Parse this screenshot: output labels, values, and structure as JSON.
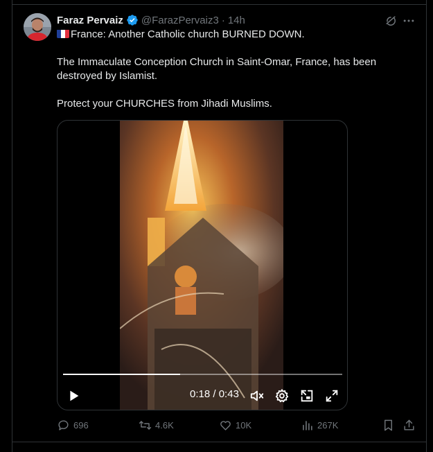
{
  "tweet": {
    "author_name": "Faraz Pervaiz",
    "handle": "@FarazPervaiz3",
    "separator": "·",
    "time": "14h",
    "verified_icon": "verified-badge-icon",
    "text_line1": "France: Another Catholic church BURNED DOWN.",
    "text_line2": "The Immaculate Conception Church in Saint-Omar, France, has been destroyed by Islamist.",
    "text_line3": "Protect your CHURCHES from Jihadi Muslims.",
    "flag_icon": "france-flag-icon"
  },
  "video": {
    "current_time": "0:18",
    "separator": "/",
    "duration": "0:43",
    "progress_fraction": 0.42,
    "controls": [
      "play-icon",
      "mute-icon",
      "settings-icon",
      "pip-icon",
      "fullscreen-icon"
    ]
  },
  "actions": {
    "replies": "696",
    "reposts": "4.6K",
    "likes": "10K",
    "views": "267K"
  },
  "colors": {
    "background": "#000000",
    "text": "#e7e9ea",
    "muted": "#71767b",
    "verified": "#1d9bf0",
    "border": "#2f3336"
  }
}
